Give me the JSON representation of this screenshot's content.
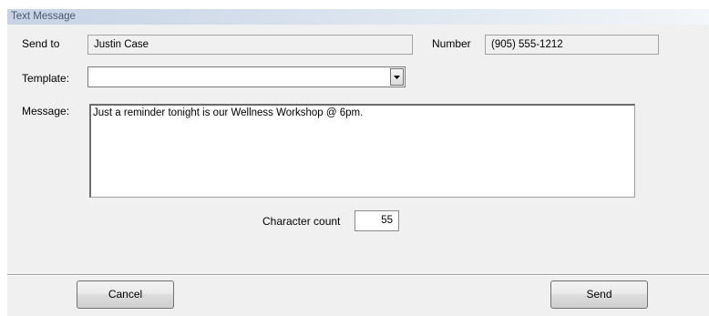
{
  "window": {
    "title": "Text Message"
  },
  "send_to": {
    "label": "Send to",
    "value": "Justin Case"
  },
  "number": {
    "label": "Number",
    "value": "(905) 555-1212"
  },
  "template": {
    "label": "Template:",
    "value": ""
  },
  "message": {
    "label": "Message:",
    "value": "Just a reminder tonight is our Wellness Workshop @ 6pm."
  },
  "character_count": {
    "label": "Character count",
    "value": "55"
  },
  "buttons": {
    "cancel": "Cancel",
    "send": "Send"
  },
  "icons": {
    "dropdown": "chevron-down-icon"
  }
}
